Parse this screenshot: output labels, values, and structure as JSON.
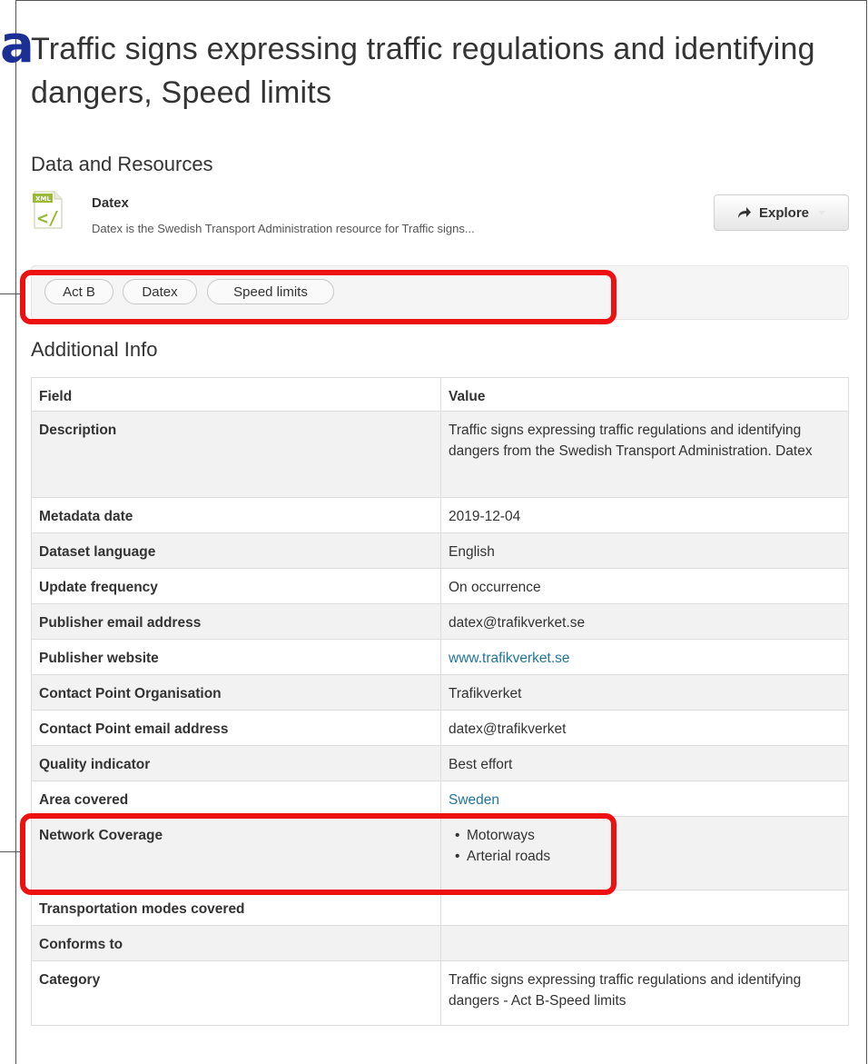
{
  "panel_label": "a",
  "dataset": {
    "title": "Traffic signs expressing traffic regulations and identifying dangers, Speed limits"
  },
  "resources": {
    "heading": "Data and Resources",
    "items": [
      {
        "icon": "xml-file-icon",
        "name": "Datex",
        "description": "Datex is the Swedish Transport Administration resource for Traffic signs...",
        "explore_label": "Explore"
      }
    ]
  },
  "tags": [
    "Act B",
    "Datex",
    "Speed limits"
  ],
  "additional_info": {
    "heading": "Additional Info",
    "columns": [
      "Field",
      "Value"
    ],
    "rows": [
      {
        "field": "Description",
        "value": "Traffic signs expressing traffic regulations and identifying dangers from the Swedish Transport Administration. Datex"
      },
      {
        "field": "Metadata date",
        "value": "2019-12-04"
      },
      {
        "field": "Dataset language",
        "value": "English"
      },
      {
        "field": "Update frequency",
        "value": "On occurrence"
      },
      {
        "field": "Publisher email address",
        "value": "datex@trafikverket.se"
      },
      {
        "field": "Publisher website",
        "value": "www.trafikverket.se"
      },
      {
        "field": "Contact Point Organisation",
        "value": "Trafikverket"
      },
      {
        "field": "Contact Point email address",
        "value": "datex@trafikverket"
      },
      {
        "field": "Quality indicator",
        "value": "Best effort"
      },
      {
        "field": "Area covered",
        "value": "Sweden"
      },
      {
        "field": "Network Coverage",
        "value_list": [
          "Motorways",
          "Arterial roads"
        ]
      },
      {
        "field": "Transportation modes covered",
        "value": ""
      },
      {
        "field": "Conforms to",
        "value": ""
      },
      {
        "field": "Category",
        "value": "Traffic signs expressing traffic regulations and identifying dangers - Act B-Speed limits"
      }
    ]
  },
  "colors": {
    "panel_label": "#1b2f95",
    "highlight": "#ee1111",
    "link": "#21759b",
    "row_shade": "#f2f2f2"
  }
}
